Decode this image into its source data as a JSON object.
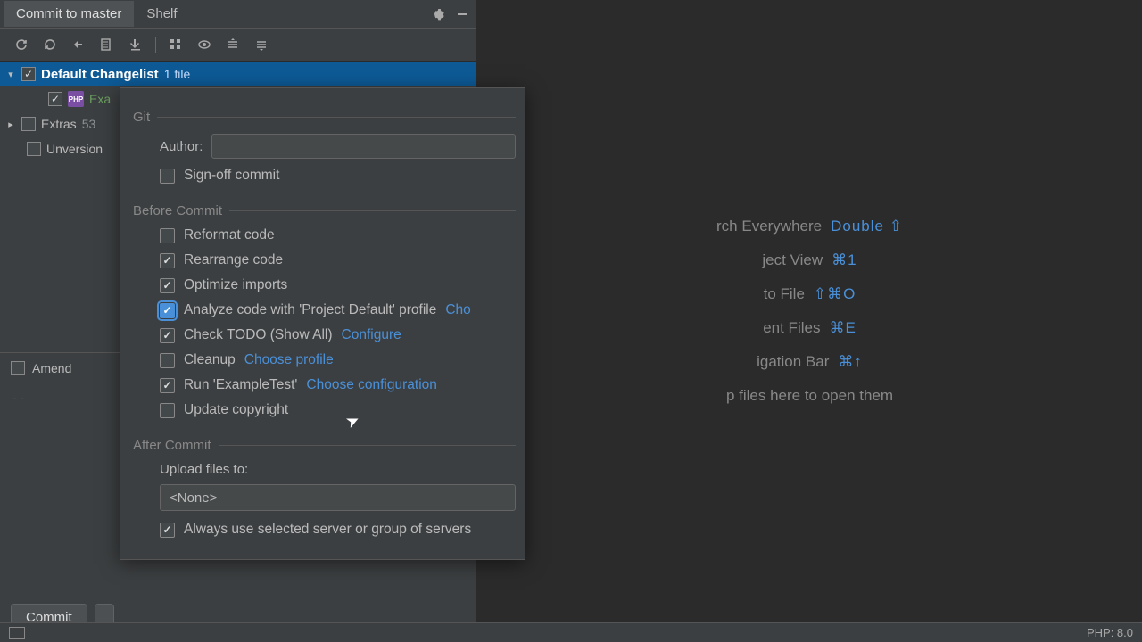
{
  "tabs": {
    "commit": "Commit to master",
    "shelf": "Shelf"
  },
  "tree": {
    "changelist": {
      "name": "Default Changelist",
      "count": "1 file"
    },
    "file": "Exa",
    "extras": {
      "name": "Extras",
      "count": "53"
    },
    "unversioned": "Unversion"
  },
  "amend": {
    "label": "Amend"
  },
  "msg_placeholder": "- -",
  "buttons": {
    "commit": "Commit"
  },
  "hints": {
    "search": {
      "label": "rch Everywhere",
      "key": "Double ⇧"
    },
    "project": {
      "label": "ject View",
      "key": "⌘1"
    },
    "gotofile": {
      "label": "to File",
      "key": "⇧⌘O"
    },
    "recent": {
      "label": "ent Files",
      "key": "⌘E"
    },
    "navbar": {
      "label": "igation Bar",
      "key": "⌘↑"
    },
    "drop": "p files here to open them"
  },
  "popup": {
    "git_head": "Git",
    "author_label": "Author:",
    "signoff": "Sign-off commit",
    "before_head": "Before Commit",
    "reformat": "Reformat code",
    "rearrange": "Rearrange code",
    "optimize": "Optimize imports",
    "analyze": "Analyze code with 'Project Default' profile",
    "analyze_link": "Cho",
    "todo": "Check TODO (Show All)",
    "todo_link": "Configure",
    "cleanup": "Cleanup",
    "cleanup_link": "Choose profile",
    "run": "Run 'ExampleTest'",
    "run_link": "Choose configuration",
    "copyright": "Update copyright",
    "after_head": "After Commit",
    "upload_label": "Upload files to:",
    "upload_value": "<None>",
    "always_server": "Always use selected server or group of servers"
  },
  "status": {
    "php": "PHP: 8.0"
  }
}
